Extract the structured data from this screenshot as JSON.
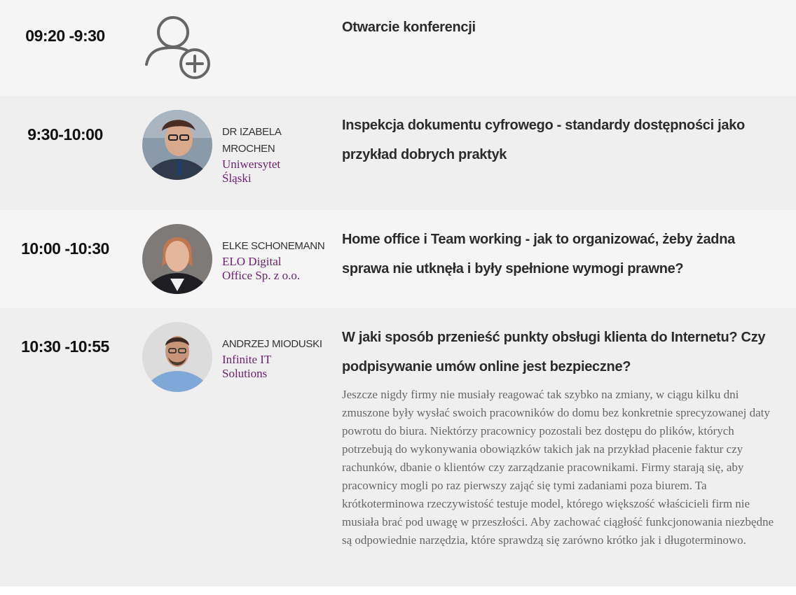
{
  "agenda": [
    {
      "time": "09:20 -9:30",
      "icon": "add-user-icon",
      "title": "Otwarcie konferencji"
    },
    {
      "time": "9:30-10:00",
      "speaker": {
        "name": "DR IZABELA MROCHEN",
        "org": "Uniwersytet Śląski"
      },
      "title": "Inspekcja dokumentu cyfrowego - standardy dostępności jako przykład dobrych praktyk"
    },
    {
      "time": "10:00 -10:30",
      "speaker": {
        "name": "ELKE SCHONEMANN",
        "org": "ELO Digital Office Sp. z o.o."
      },
      "title": "Home office i Team working - jak to organizować, żeby żadna sprawa nie utknęła i były spełnione wymogi prawne?"
    },
    {
      "time": "10:30 -10:55",
      "speaker": {
        "name": "ANDRZEJ MIODUSKI",
        "org": "Infinite IT Solutions"
      },
      "title": "W jaki sposób przenieść punkty obsługi klienta do Internetu? Czy podpisywanie umów online jest bezpieczne?",
      "description": "Jeszcze nigdy firmy nie musiały reagować tak szybko na zmiany, w ciągu kilku dni zmuszone były wysłać swoich pracowników do domu bez konkretnie sprecyzowanej daty powrotu do biura. Niektórzy pracownicy pozostali bez dostępu do plików, których potrzebują do wykonywania obowiązków takich jak na przykład płacenie faktur czy rachunków, dbanie o klientów czy zarządzanie pracownikami. Firmy starają się, aby pracownicy mogli po raz pierwszy zająć się tymi zadaniami poza biurem. Ta krótkoterminowa rzeczywistość testuje model, którego większość właścicieli firm nie musiała brać pod uwagę w przeszłości. Aby zachować ciągłość funkcjonowania niezbędne są odpowiednie narzędzia, które sprawdzą się zarówno krótko jak i długoterminowo."
    }
  ],
  "colors": {
    "row_light": "#f5f5f5",
    "row_dark": "#efefef",
    "org_accent": "#6b1f6e",
    "title_text": "#2b2b2b"
  }
}
